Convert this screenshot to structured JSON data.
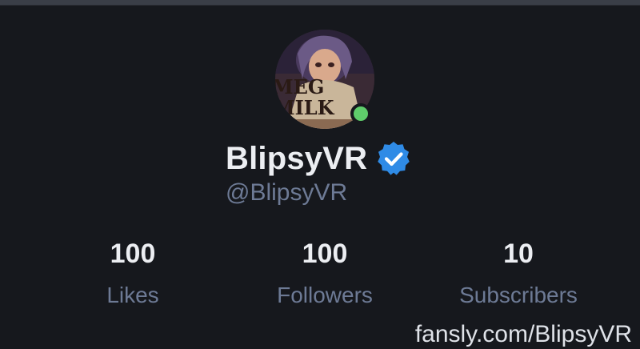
{
  "profile": {
    "display_name": "BlipsyVR",
    "handle": "@BlipsyVR",
    "verified": true,
    "online": true,
    "avatar_icon": "avatar-image",
    "avatar_text": "MEG MILK"
  },
  "stats": [
    {
      "count": "100",
      "label": "Likes"
    },
    {
      "count": "100",
      "label": "Followers"
    },
    {
      "count": "10",
      "label": "Subscribers"
    }
  ],
  "watermark": "fansly.com/BlipsyVR",
  "colors": {
    "background": "#16181d",
    "primary_text": "#eceef2",
    "secondary_text": "#6d7a95",
    "verified_badge": "#2f8be6",
    "online_indicator": "#5fcd6b"
  }
}
